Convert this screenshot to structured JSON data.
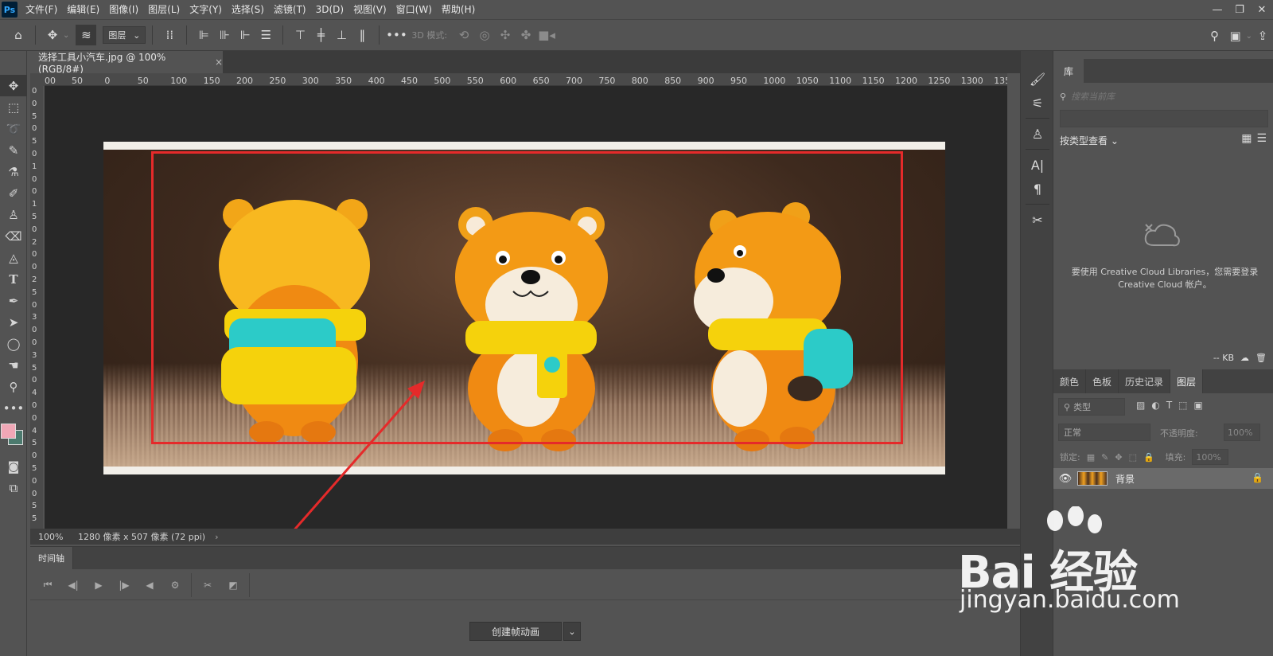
{
  "menubar": {
    "app_icon": "Ps",
    "items": [
      "文件(F)",
      "编辑(E)",
      "图像(I)",
      "图层(L)",
      "文字(Y)",
      "选择(S)",
      "滤镜(T)",
      "3D(D)",
      "视图(V)",
      "窗口(W)",
      "帮助(H)"
    ]
  },
  "options_bar": {
    "layer_select": "图层",
    "mode_3d": "3D 模式:"
  },
  "document": {
    "tab_title": "选择工具小汽车.jpg @ 100%(RGB/8#)",
    "close": "×"
  },
  "ruler": {
    "h_labels": [
      "00",
      "50",
      "0",
      "50",
      "100",
      "150",
      "200",
      "250",
      "300",
      "350",
      "400",
      "450",
      "500",
      "550",
      "600",
      "650",
      "700",
      "750",
      "800",
      "850",
      "900",
      "950",
      "1000",
      "1050",
      "1100",
      "1150",
      "1200",
      "1250",
      "1300",
      "135"
    ],
    "v_labels": [
      "0",
      "0",
      "5",
      "0",
      "5",
      "0",
      "1",
      "0",
      "0",
      "1",
      "5",
      "0",
      "2",
      "0",
      "0",
      "2",
      "5",
      "0",
      "3",
      "0",
      "0",
      "3",
      "5",
      "0",
      "4",
      "0",
      "0",
      "4",
      "5",
      "0",
      "5",
      "0",
      "0",
      "5",
      "5"
    ]
  },
  "statusbar": {
    "zoom": "100%",
    "doc_info": "1280 像素 x 507 像素 (72 ppi)",
    "more": "›"
  },
  "timeline": {
    "tab": "时间轴",
    "create_button": "创建帧动画",
    "dropdown": "⌄"
  },
  "library": {
    "tab": "库",
    "search_placeholder": "搜索当前库",
    "view_label": "按类型查看",
    "message": "要使用 Creative Cloud Libraries，您需要登录 Creative Cloud 帐户。",
    "footer_size": "-- KB"
  },
  "layers_panel": {
    "tabs": [
      "颜色",
      "色板",
      "历史记录",
      "图层"
    ],
    "filter": "类型",
    "blend_mode": "正常",
    "opacity_label": "不透明度:",
    "opacity_value": "100%",
    "lock_label": "锁定:",
    "fill_label": "填充:",
    "fill_value": "100%",
    "layer_name": "背景"
  },
  "watermark": {
    "brand": "Bai 经验",
    "url": "jingyan.baidu.com"
  },
  "colors": {
    "foreground": "#f0a7b6",
    "background": "#4c7a6e",
    "selection_box": "#e52a2a"
  }
}
